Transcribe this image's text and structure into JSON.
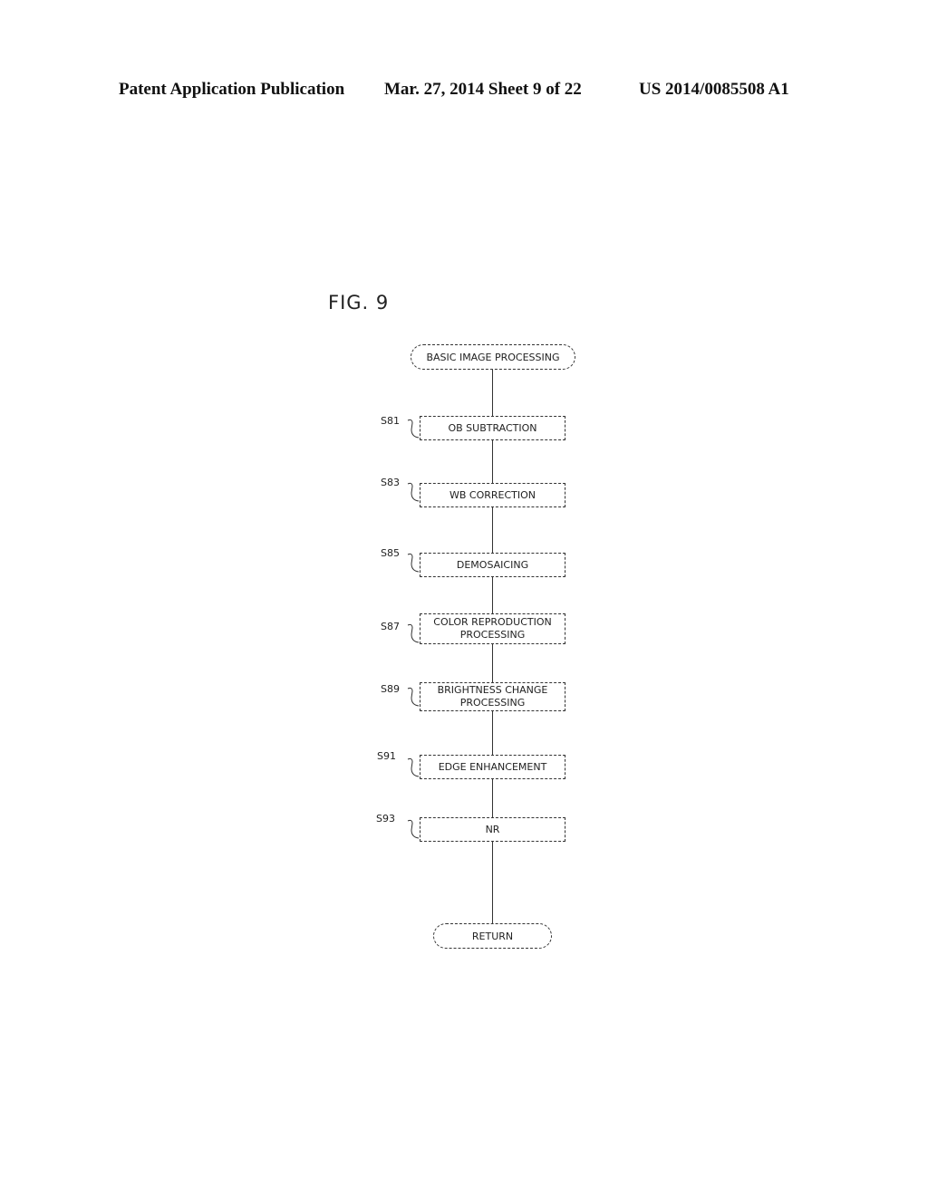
{
  "header": {
    "publication": "Patent Application Publication",
    "date_sheet": "Mar. 27, 2014  Sheet 9 of 22",
    "number": "US 2014/0085508 A1"
  },
  "figure": {
    "title": "FIG. 9",
    "start": "BASIC IMAGE PROCESSING",
    "steps": [
      {
        "label": "S81",
        "text": "OB SUBTRACTION"
      },
      {
        "label": "S83",
        "text": "WB CORRECTION"
      },
      {
        "label": "S85",
        "text": "DEMOSAICING"
      },
      {
        "label": "S87",
        "text": "COLOR REPRODUCTION\nPROCESSING"
      },
      {
        "label": "S89",
        "text": "BRIGHTNESS CHANGE\nPROCESSING"
      },
      {
        "label": "S91",
        "text": "EDGE ENHANCEMENT"
      },
      {
        "label": "S93",
        "text": "NR"
      }
    ],
    "end": "RETURN"
  }
}
